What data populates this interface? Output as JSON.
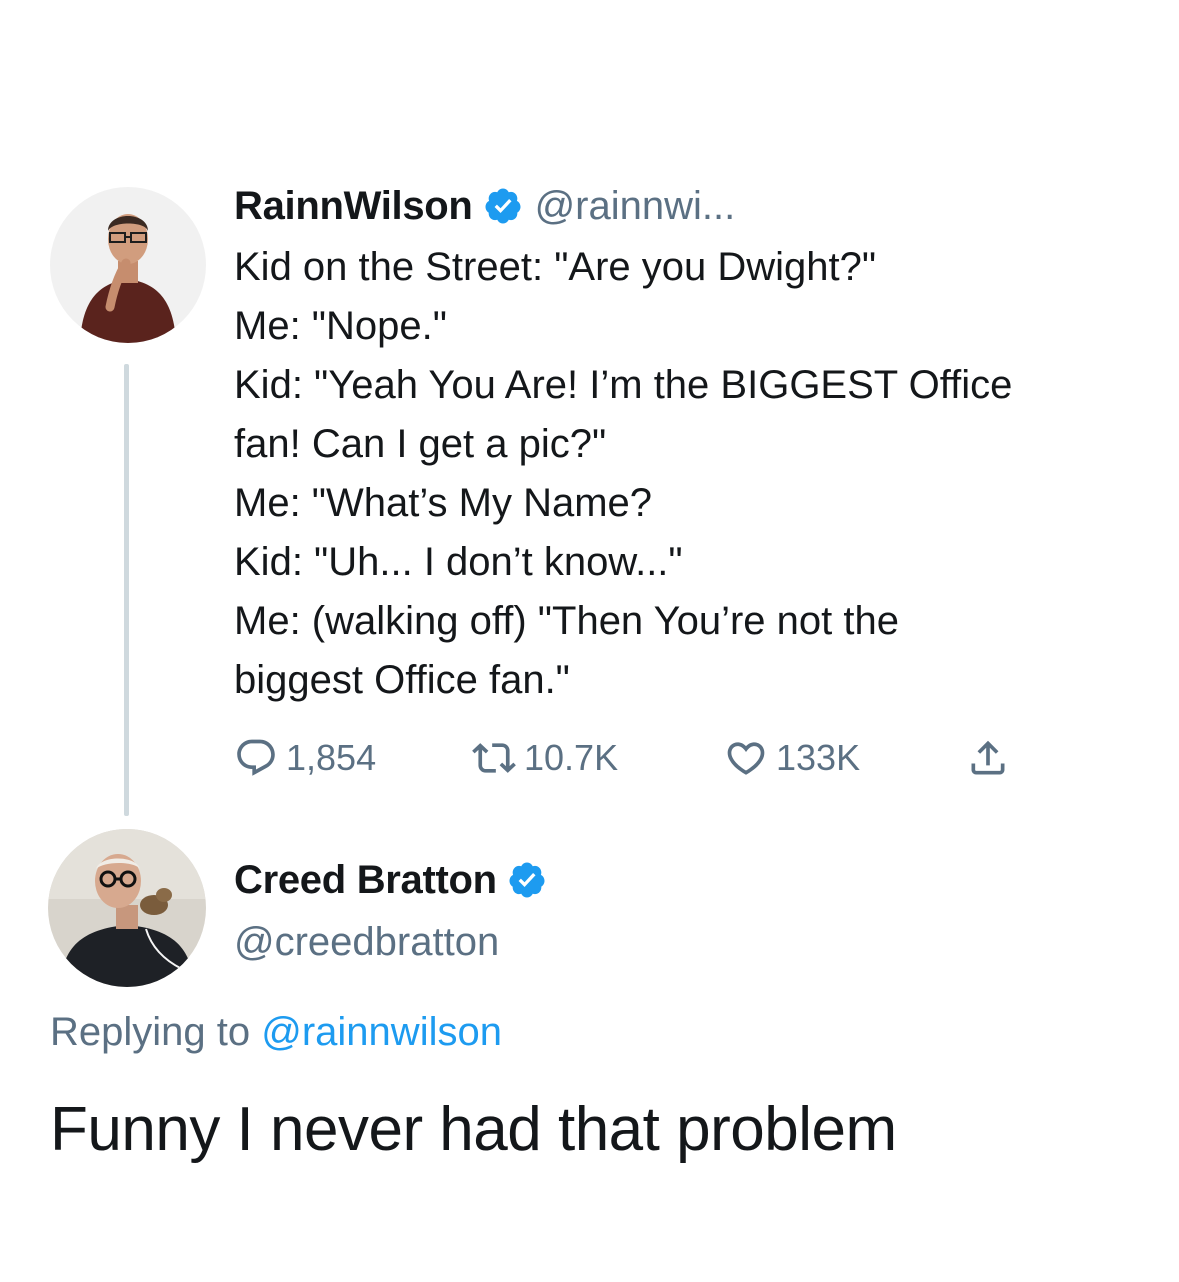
{
  "tweet": {
    "author": {
      "display_name": "RainnWilson",
      "handle": "@rainnwi...",
      "verified": true
    },
    "body_lines": [
      "Kid on the Street: \"Are you Dwight?\"",
      "Me: \"Nope.\"",
      "Kid: \"Yeah You Are! I’m the BIGGEST Office",
      "fan! Can I get a pic?\"",
      "Me: \"What’s My Name?",
      "Kid: \"Uh... I don’t know...\"",
      "Me: (walking off) \"Then You’re not the",
      "biggest Office fan.\""
    ],
    "stats": {
      "replies": "1,854",
      "retweets": "10.7K",
      "likes": "133K"
    }
  },
  "reply": {
    "author": {
      "display_name": "Creed Bratton",
      "handle": "@creedbratton",
      "verified": true
    },
    "replying_to_prefix": "Replying to",
    "replying_to_handle": "@rainnwilson",
    "text": "Funny I never had that problem"
  },
  "colors": {
    "accent": "#1d9bf0",
    "secondary_text": "#5b7083",
    "primary_text": "#14171a",
    "thread_line": "#cfd9de"
  },
  "icons": [
    "reply-icon",
    "retweet-icon",
    "like-icon",
    "share-icon",
    "verified-badge-icon"
  ]
}
